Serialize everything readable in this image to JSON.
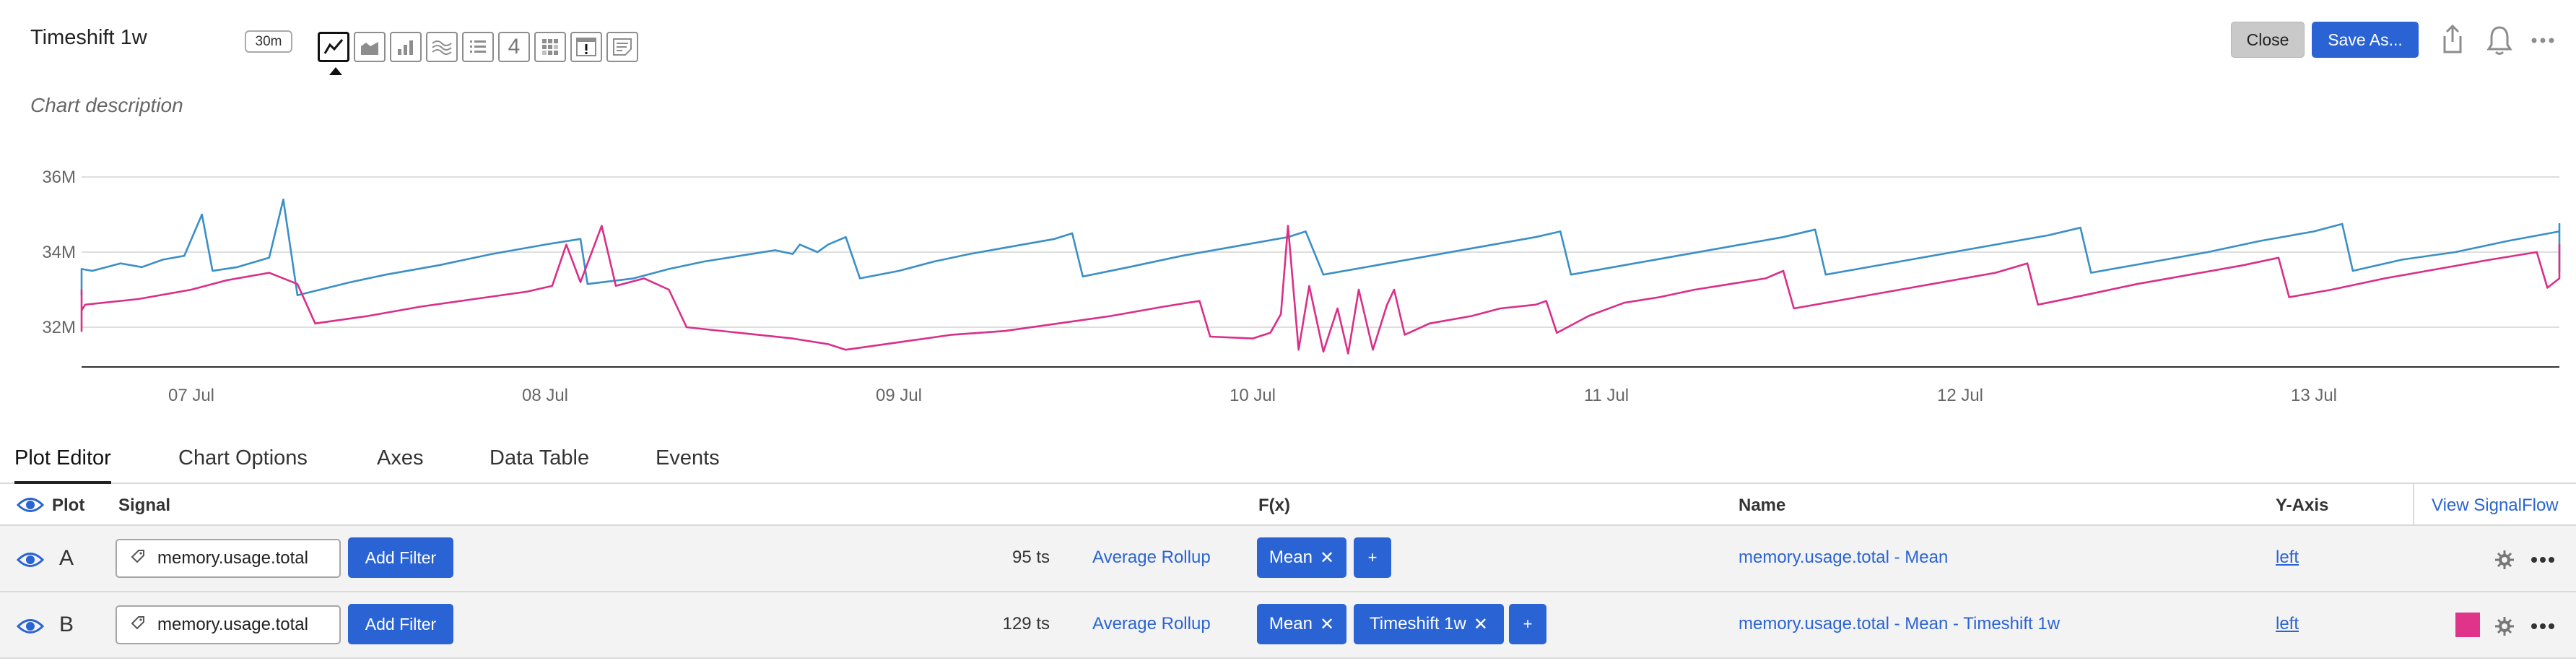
{
  "header": {
    "title": "Timeshift 1w",
    "resolution": "30m",
    "chart_type_icons": [
      "line-chart-icon",
      "area-chart-icon",
      "column-chart-icon",
      "histogram-icon",
      "list-icon",
      "single-value-icon",
      "heatmap-icon",
      "event-feed-icon",
      "text-note-icon"
    ],
    "single_value_label": "4",
    "close_label": "Close",
    "save_as_label": "Save As...",
    "description": "Chart description"
  },
  "chart_data": {
    "type": "line",
    "y_ticks": [
      "36M",
      "34M",
      "32M"
    ],
    "ylim": [
      31000000,
      36500000
    ],
    "x_ticks": [
      "07 Jul",
      "08 Jul",
      "09 Jul",
      "10 Jul",
      "11 Jul",
      "12 Jul",
      "13 Jul"
    ],
    "x_tick_values": [
      0.5,
      1.5,
      2.5,
      3.5,
      4.5,
      5.5,
      6.5
    ],
    "xlim": [
      -0.28,
      6.72
    ],
    "grid": true,
    "series": [
      {
        "color": "#3a8fc7",
        "points": [
          [
            -0.28,
            32.85
          ],
          [
            -0.15,
            33.05
          ],
          [
            -0.05,
            33.3
          ],
          [
            0.05,
            33.4
          ],
          [
            0.15,
            33.55
          ],
          [
            0.22,
            33.5
          ],
          [
            0.3,
            33.7
          ],
          [
            0.36,
            33.6
          ],
          [
            0.42,
            33.8
          ],
          [
            0.48,
            33.9
          ],
          [
            0.53,
            35.0
          ],
          [
            0.56,
            33.5
          ],
          [
            0.63,
            33.6
          ],
          [
            0.72,
            33.85
          ],
          [
            0.76,
            35.4
          ],
          [
            0.8,
            32.85
          ],
          [
            0.95,
            33.2
          ],
          [
            1.05,
            33.4
          ],
          [
            1.2,
            33.65
          ],
          [
            1.35,
            33.95
          ],
          [
            1.5,
            34.2
          ],
          [
            1.6,
            34.35
          ],
          [
            1.62,
            33.15
          ],
          [
            1.75,
            33.3
          ],
          [
            1.85,
            33.55
          ],
          [
            1.95,
            33.75
          ],
          [
            2.05,
            33.9
          ],
          [
            2.15,
            34.05
          ],
          [
            2.2,
            33.95
          ],
          [
            2.22,
            34.2
          ],
          [
            2.27,
            34.0
          ],
          [
            2.3,
            34.2
          ],
          [
            2.35,
            34.4
          ],
          [
            2.39,
            33.3
          ],
          [
            2.5,
            33.5
          ],
          [
            2.6,
            33.75
          ],
          [
            2.7,
            33.95
          ],
          [
            2.82,
            34.15
          ],
          [
            2.94,
            34.35
          ],
          [
            2.99,
            34.5
          ],
          [
            3.02,
            33.35
          ],
          [
            3.15,
            33.6
          ],
          [
            3.3,
            33.9
          ],
          [
            3.45,
            34.15
          ],
          [
            3.6,
            34.4
          ],
          [
            3.65,
            34.55
          ],
          [
            3.7,
            33.4
          ],
          [
            3.85,
            33.65
          ],
          [
            4.0,
            33.9
          ],
          [
            4.15,
            34.15
          ],
          [
            4.3,
            34.4
          ],
          [
            4.37,
            34.55
          ],
          [
            4.4,
            33.4
          ],
          [
            4.55,
            33.65
          ],
          [
            4.7,
            33.9
          ],
          [
            4.85,
            34.15
          ],
          [
            5.0,
            34.4
          ],
          [
            5.09,
            34.6
          ],
          [
            5.12,
            33.4
          ],
          [
            5.3,
            33.7
          ],
          [
            5.45,
            33.95
          ],
          [
            5.6,
            34.2
          ],
          [
            5.75,
            34.45
          ],
          [
            5.84,
            34.65
          ],
          [
            5.87,
            33.45
          ],
          [
            6.05,
            33.75
          ],
          [
            6.2,
            34.0
          ],
          [
            6.35,
            34.3
          ],
          [
            6.5,
            34.55
          ],
          [
            6.58,
            34.75
          ],
          [
            6.61,
            33.5
          ],
          [
            6.75,
            33.8
          ],
          [
            6.9,
            34.0
          ],
          [
            7.05,
            34.3
          ],
          [
            7.2,
            34.55
          ],
          [
            7.32,
            34.75
          ],
          [
            7.36,
            33.5
          ],
          [
            7.45,
            33.75
          ],
          [
            7.58,
            34.05
          ],
          [
            7.72,
            34.3
          ],
          [
            7.83,
            34.55
          ],
          [
            7.9,
            33.9
          ]
        ]
      },
      {
        "color": "#d92f89",
        "points": [
          [
            -0.28,
            33.0
          ],
          [
            -0.26,
            31.9
          ],
          [
            -0.1,
            32.15
          ],
          [
            0.05,
            32.45
          ],
          [
            0.2,
            32.6
          ],
          [
            0.35,
            32.75
          ],
          [
            0.5,
            33.0
          ],
          [
            0.6,
            33.25
          ],
          [
            0.72,
            33.45
          ],
          [
            0.8,
            33.15
          ],
          [
            0.85,
            32.1
          ],
          [
            1.0,
            32.3
          ],
          [
            1.15,
            32.55
          ],
          [
            1.3,
            32.75
          ],
          [
            1.45,
            32.95
          ],
          [
            1.52,
            33.1
          ],
          [
            1.56,
            34.2
          ],
          [
            1.6,
            33.2
          ],
          [
            1.66,
            34.7
          ],
          [
            1.7,
            33.1
          ],
          [
            1.78,
            33.3
          ],
          [
            1.85,
            33.0
          ],
          [
            1.9,
            32.0
          ],
          [
            2.05,
            31.85
          ],
          [
            2.2,
            31.7
          ],
          [
            2.3,
            31.55
          ],
          [
            2.35,
            31.4
          ],
          [
            2.5,
            31.6
          ],
          [
            2.65,
            31.8
          ],
          [
            2.8,
            31.9
          ],
          [
            2.95,
            32.1
          ],
          [
            3.1,
            32.3
          ],
          [
            3.25,
            32.55
          ],
          [
            3.35,
            32.7
          ],
          [
            3.38,
            31.75
          ],
          [
            3.5,
            31.7
          ],
          [
            3.55,
            31.85
          ],
          [
            3.58,
            32.35
          ],
          [
            3.6,
            34.7
          ],
          [
            3.63,
            31.4
          ],
          [
            3.66,
            33.1
          ],
          [
            3.7,
            31.35
          ],
          [
            3.74,
            32.5
          ],
          [
            3.77,
            31.3
          ],
          [
            3.8,
            33.0
          ],
          [
            3.84,
            31.4
          ],
          [
            3.88,
            32.6
          ],
          [
            3.9,
            33.0
          ],
          [
            3.93,
            31.8
          ],
          [
            4.0,
            32.1
          ],
          [
            4.12,
            32.3
          ],
          [
            4.2,
            32.5
          ],
          [
            4.3,
            32.6
          ],
          [
            4.33,
            32.7
          ],
          [
            4.36,
            31.85
          ],
          [
            4.45,
            32.3
          ],
          [
            4.55,
            32.65
          ],
          [
            4.65,
            32.8
          ],
          [
            4.75,
            33.0
          ],
          [
            4.85,
            33.15
          ],
          [
            4.95,
            33.3
          ],
          [
            5.0,
            33.5
          ],
          [
            5.03,
            32.5
          ],
          [
            5.15,
            32.7
          ],
          [
            5.3,
            32.95
          ],
          [
            5.45,
            33.2
          ],
          [
            5.6,
            33.45
          ],
          [
            5.69,
            33.7
          ],
          [
            5.72,
            32.6
          ],
          [
            5.85,
            32.85
          ],
          [
            6.0,
            33.15
          ],
          [
            6.15,
            33.4
          ],
          [
            6.3,
            33.65
          ],
          [
            6.4,
            33.85
          ],
          [
            6.43,
            32.8
          ],
          [
            6.55,
            33.0
          ],
          [
            6.7,
            33.3
          ],
          [
            6.85,
            33.55
          ],
          [
            7.0,
            33.8
          ],
          [
            7.13,
            34.0
          ],
          [
            7.16,
            33.05
          ],
          [
            7.3,
            33.3
          ],
          [
            7.45,
            33.6
          ],
          [
            7.6,
            33.8
          ],
          [
            7.75,
            34.0
          ],
          [
            7.85,
            34.2
          ],
          [
            7.9,
            33.5
          ]
        ]
      }
    ]
  },
  "tabs": [
    "Plot Editor",
    "Chart Options",
    "Axes",
    "Data Table",
    "Events"
  ],
  "table": {
    "headers": {
      "plot": "Plot",
      "signal": "Signal",
      "fx": "F(x)",
      "name": "Name",
      "yaxis": "Y-Axis",
      "view_signalflow": "View SignalFlow"
    },
    "rows": [
      {
        "letter": "A",
        "signal": "memory.usage.total",
        "add_filter": "Add Filter",
        "ts_count": "95 ts",
        "rollup": "Average Rollup",
        "functions": [
          "Mean"
        ],
        "plus": "+",
        "name": "memory.usage.total - Mean",
        "yaxis": "left"
      },
      {
        "letter": "B",
        "signal": "memory.usage.total",
        "add_filter": "Add Filter",
        "ts_count": "129 ts",
        "rollup": "Average Rollup",
        "functions": [
          "Mean",
          "Timeshift 1w"
        ],
        "plus": "+",
        "name": "memory.usage.total - Mean - Timeshift 1w",
        "yaxis": "left",
        "color": "#e0338a"
      }
    ]
  }
}
